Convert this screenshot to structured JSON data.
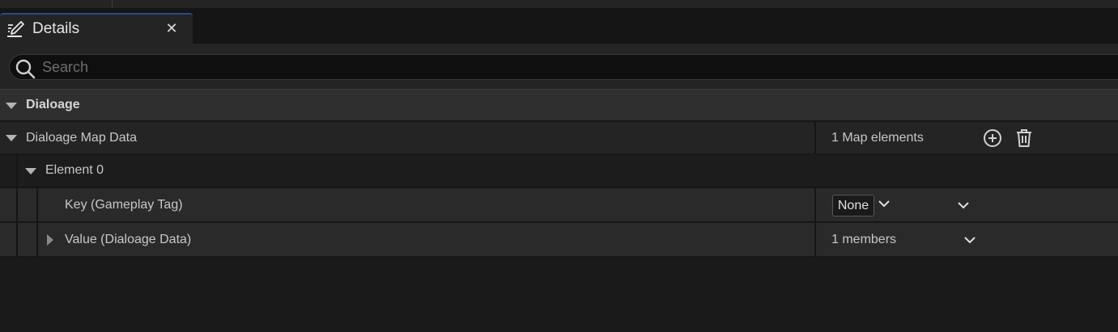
{
  "tab": {
    "title": "Details",
    "icon": "pencil-note-icon",
    "close_icon": "close-icon"
  },
  "search": {
    "placeholder": "Search",
    "value": ""
  },
  "category": {
    "label": "Dialoage",
    "expanded": true
  },
  "properties": {
    "map": {
      "label": "Dialoage Map Data",
      "value": "1 Map elements",
      "expanded": true,
      "add_icon": "add-circle-icon",
      "delete_icon": "trash-icon"
    },
    "element": {
      "label": "Element 0",
      "expanded": true
    },
    "key": {
      "label": "Key (Gameplay Tag)",
      "value": "None"
    },
    "value": {
      "label": "Value (Dialoage Data)",
      "value": "1 members",
      "expanded": false
    }
  },
  "colors": {
    "background": "#1a1a1a",
    "panel": "#242424",
    "category_bg": "#2f2f2f",
    "text": "#c8c8c8",
    "tab_accent": "#2a4a8a"
  }
}
